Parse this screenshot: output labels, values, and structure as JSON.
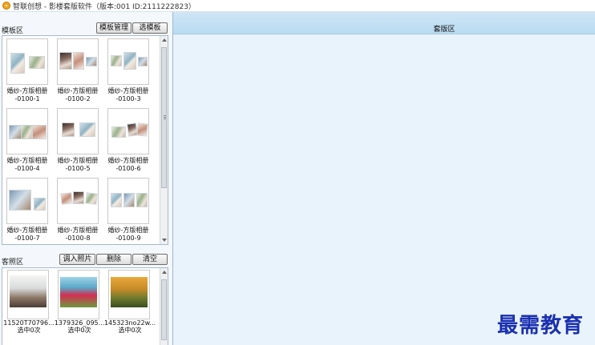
{
  "window": {
    "title": "智联创想 - 影楼套版软件（版本:001  ID:2111222823）"
  },
  "template_panel": {
    "label": "模板区",
    "buttons": {
      "manage": "模板管理",
      "select": "选模板"
    },
    "templates": [
      {
        "line1": "婚纱-方版相册",
        "line2": "-0100-1"
      },
      {
        "line1": "婚纱-方版相册",
        "line2": "-0100-2"
      },
      {
        "line1": "婚纱-方版相册",
        "line2": "-0100-3"
      },
      {
        "line1": "婚纱-方版相册",
        "line2": "-0100-4"
      },
      {
        "line1": "婚纱-方版相册",
        "line2": "-0100-5"
      },
      {
        "line1": "婚纱-方版相册",
        "line2": "-0100-6"
      },
      {
        "line1": "婚纱-方版相册",
        "line2": "-0100-7"
      },
      {
        "line1": "婚纱-方版相册",
        "line2": "-0100-8"
      },
      {
        "line1": "婚纱-方版相册",
        "line2": "-0100-9"
      }
    ]
  },
  "photo_panel": {
    "label": "客照区",
    "buttons": {
      "import": "调入照片",
      "delete": "删除",
      "clear": "清空"
    },
    "photos": [
      {
        "name": "11520T70796...",
        "count": "选中0次"
      },
      {
        "name": "1379326_095...",
        "count": "选中0次"
      },
      {
        "name": "145323no22w...",
        "count": "选中0次"
      }
    ]
  },
  "work_area": {
    "label": "套版区"
  },
  "watermark": "最需教育"
}
